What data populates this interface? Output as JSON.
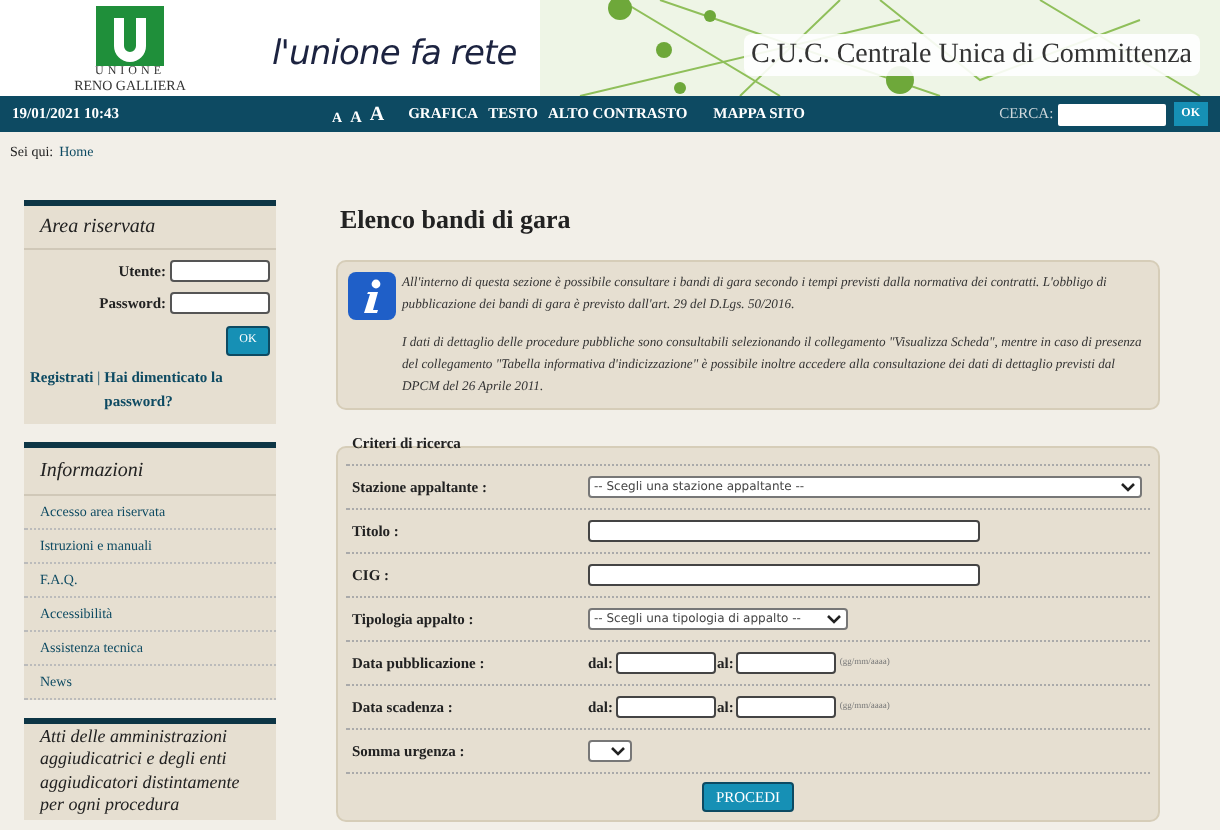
{
  "header": {
    "logo_top": "UNIONE",
    "logo_bottom": "RENO GALLIERA",
    "slogan": "l'unione fa rete",
    "site_title": "C.U.C. Centrale Unica di Committenza"
  },
  "navbar": {
    "datetime": "19/01/2021 10:43",
    "font_sizes": [
      "A",
      "A",
      "A"
    ],
    "links": [
      "GRAFICA",
      "TESTO",
      "ALTO CONTRASTO",
      "MAPPA SITO"
    ],
    "search_label": "CERCA:",
    "search_button": "OK"
  },
  "breadcrumb": {
    "label": "Sei qui:",
    "link": "Home"
  },
  "sidebar": {
    "login": {
      "title": "Area riservata",
      "user_label": "Utente:",
      "password_label": "Password:",
      "button": "OK",
      "register": "Registrati",
      "separator": "|",
      "forgot": "Hai dimenticato la password?"
    },
    "info": {
      "title": "Informazioni",
      "items": [
        "Accesso area riservata",
        "Istruzioni e manuali",
        "F.A.Q.",
        "Accessibilità",
        "Assistenza tecnica",
        "News"
      ]
    },
    "acts": {
      "title": "Atti delle amministrazioni aggiudicatrici e degli enti aggiudicatori distintamente per ogni procedura"
    }
  },
  "main": {
    "title": "Elenco bandi di gara",
    "info_paragraphs": [
      "All'interno di questa sezione è possibile consultare i bandi di gara secondo i tempi previsti dalla normativa dei contratti. L'obbligo di pubblicazione dei bandi di gara è previsto dall'art. 29 del D.Lgs. 50/2016.",
      "I dati di dettaglio delle procedure pubbliche sono consultabili selezionando il collegamento \"Visualizza Scheda\", mentre in caso di presenza del collegamento \"Tabella informativa d'indicizzazione\" è possibile inoltre accedere alla consultazione dei dati di dettaglio previsti dal DPCM del 26 Aprile 2011."
    ],
    "criteria": {
      "legend": "Criteri di ricerca",
      "fields": [
        {
          "kind": "longselect",
          "label": "Stazione appaltante :",
          "value": "-- Scegli una stazione appaltante --"
        },
        {
          "kind": "text",
          "label": "Titolo :"
        },
        {
          "kind": "text",
          "label": "CIG :"
        },
        {
          "kind": "select",
          "label": "Tipologia appalto :",
          "value": "-- Scegli una tipologia di appalto --"
        },
        {
          "kind": "daterange",
          "label": "Data pubblicazione :",
          "from": "dal:",
          "to": "al:",
          "hint": "(gg/mm/aaaa)"
        },
        {
          "kind": "daterange",
          "label": "Data scadenza :",
          "from": "dal:",
          "to": "al:",
          "hint": "(gg/mm/aaaa)"
        },
        {
          "kind": "shortselect",
          "label": "Somma urgenza :"
        }
      ],
      "button": "PROCEDI"
    }
  }
}
